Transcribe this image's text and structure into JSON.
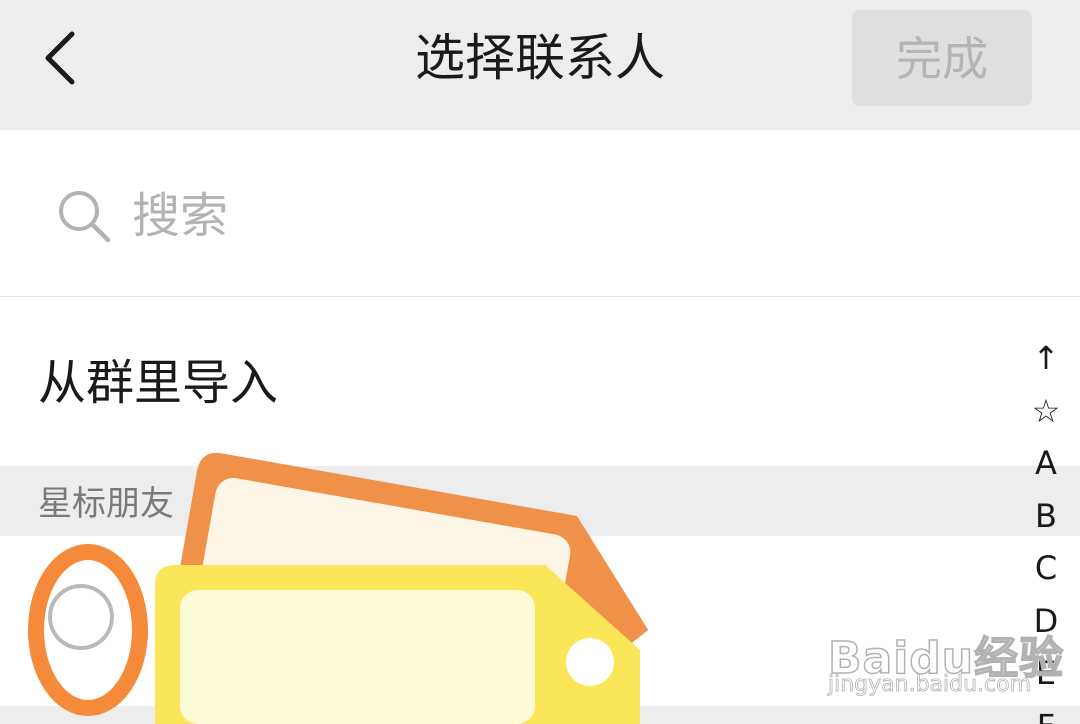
{
  "header": {
    "title": "选择联系人",
    "done_label": "完成"
  },
  "search": {
    "placeholder": "搜索"
  },
  "import_from_group": {
    "label": "从群里导入"
  },
  "section": {
    "title": "星标朋友"
  },
  "index_bar": {
    "items": [
      "↑",
      "☆",
      "A",
      "B",
      "C",
      "D",
      "E",
      "F"
    ]
  },
  "watermark": {
    "logo": "Baidu经验",
    "url": "jingyan.baidu.com"
  },
  "colors": {
    "topbar_bg": "#ededed",
    "done_button_bg": "#dfdfdf",
    "done_button_text": "#b4b4b4",
    "tag_orange": "#f0914a",
    "tag_yellow": "#fbe65a",
    "highlight_ring": "#f58a3a"
  },
  "icons": {
    "back": "chevron-left-icon",
    "search": "search-icon",
    "radio": "radio-unchecked-icon",
    "sticker": "tag-sticker"
  }
}
